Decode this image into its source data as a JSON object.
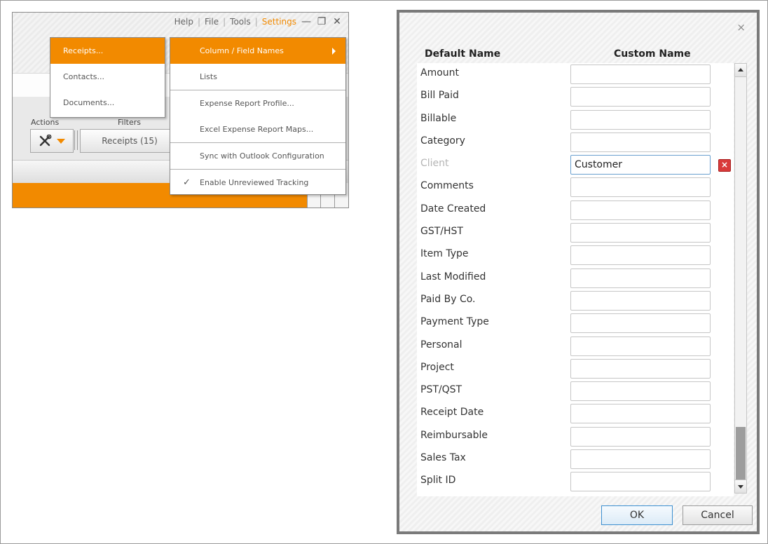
{
  "app": {
    "menubar": {
      "help": "Help",
      "file": "File",
      "tools": "Tools",
      "settings": "Settings",
      "separator": "|"
    },
    "window_controls": {
      "minimize": "—",
      "restore": "❐",
      "close": "✕"
    },
    "labels": {
      "actions": "Actions",
      "filters": "Filters"
    },
    "receipts_button": "Receipts (15)",
    "accent_color": "#f28a00",
    "submenu_left": [
      "Receipts...",
      "Contacts...",
      "Documents..."
    ],
    "submenu_right": {
      "column_field_names": "Column / Field Names",
      "lists": "Lists",
      "expense_report_profile": "Expense Report Profile...",
      "excel_expense_report_maps": "Excel Expense Report Maps...",
      "sync_outlook": "Sync with Outlook Configuration",
      "enable_unreviewed": "Enable Unreviewed Tracking",
      "check": "✓"
    }
  },
  "dialog": {
    "close": "×",
    "header_default": "Default Name",
    "header_custom": "Custom Name",
    "rows": [
      {
        "name": "Amount",
        "value": ""
      },
      {
        "name": "Bill Paid",
        "value": ""
      },
      {
        "name": "Billable",
        "value": ""
      },
      {
        "name": "Category",
        "value": ""
      },
      {
        "name": "Client",
        "value": "Customer"
      },
      {
        "name": "Comments",
        "value": ""
      },
      {
        "name": "Date Created",
        "value": ""
      },
      {
        "name": "GST/HST",
        "value": ""
      },
      {
        "name": "Item Type",
        "value": ""
      },
      {
        "name": "Last Modified",
        "value": ""
      },
      {
        "name": "Paid By Co.",
        "value": ""
      },
      {
        "name": "Payment Type",
        "value": ""
      },
      {
        "name": "Personal",
        "value": ""
      },
      {
        "name": "Project",
        "value": ""
      },
      {
        "name": "PST/QST",
        "value": ""
      },
      {
        "name": "Receipt Date",
        "value": ""
      },
      {
        "name": "Reimbursable",
        "value": ""
      },
      {
        "name": "Sales Tax",
        "value": ""
      },
      {
        "name": "Split ID",
        "value": ""
      }
    ],
    "clear_glyph": "×",
    "ok": "OK",
    "cancel": "Cancel"
  }
}
